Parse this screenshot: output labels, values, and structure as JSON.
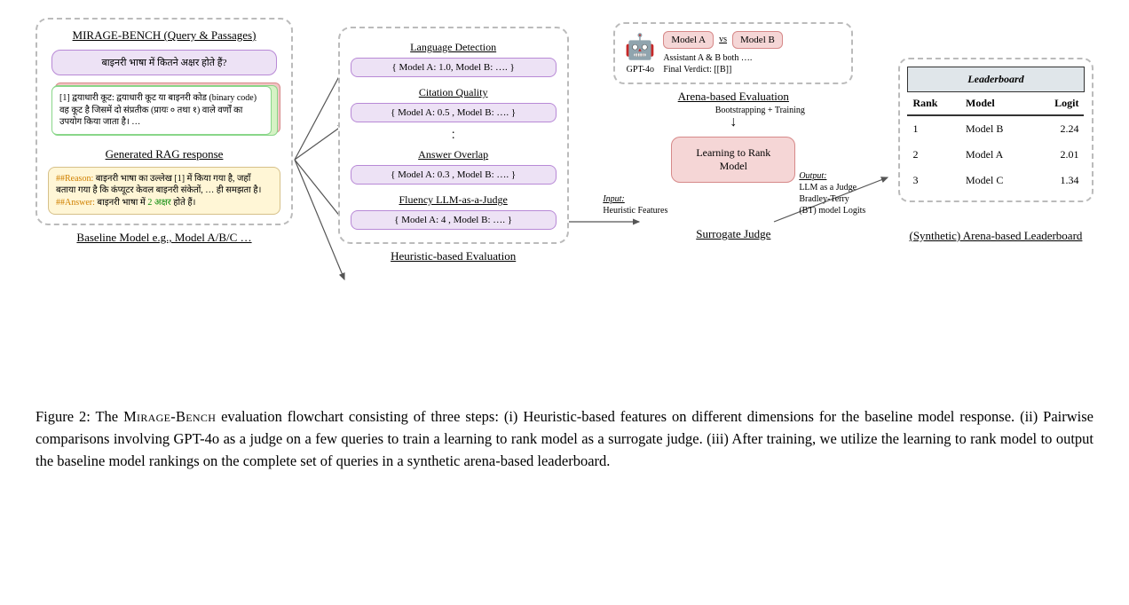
{
  "col1": {
    "title": "MIRAGE-BENCH (Query & Passages)",
    "query": "बाइनरी भाषा में कितने अक्षर होते हैं?",
    "passage": "[1] द्वयाधारी कूट: द्वयाधारी कूट या बाइनरी कोड (binary code) वह कूट है जिसमें दो संप्रतीक (प्रायः ० तथा १) वाले वर्णों का उपयोग किया जाता है। …",
    "rag_title": "Generated RAG response",
    "rag_reason_label": "##Reason:",
    "rag_reason": " बाइनरी भाषा का उल्लेख [1] में किया गया है, जहाँ बताया गया है कि कंप्यूटर केवल बाइनरी संकेतों, … ही समझता है।",
    "rag_answer_label": "##Answer:",
    "rag_answer_a": " बाइनरी भाषा में ",
    "rag_answer_b": "2 अक्षर",
    "rag_answer_c": " होते हैं।",
    "caption": "Baseline Model e.g., Model A/B/C …"
  },
  "col2": {
    "metrics": [
      {
        "title": "Language Detection",
        "value": "{ Model A:  1.0, Model B: …. }"
      },
      {
        "title": "Citation Quality",
        "value": "{ Model A:  0.5 , Model B: …. }"
      },
      {
        "title": "Answer Overlap",
        "value": "{ Model A:  0.3 , Model B: …. }"
      },
      {
        "title": "Fluency LLM-as-a-Judge",
        "value": "{ Model A:  4 , Model B: …. }"
      }
    ],
    "caption": "Heuristic-based Evaluation"
  },
  "col3": {
    "model_a": "Model A",
    "vs": "vs",
    "model_b": "Model B",
    "assistant_line": "Assistant A & B both ….",
    "verdict_line": "Final Verdict: [[B]]",
    "gpt_label": "GPT-4o",
    "arena_label": "Arena-based Evaluation",
    "boot_label": "Bootstrapping + Training",
    "ltr": "Learning to Rank Model",
    "input_title": "Input:",
    "input_text": "Heuristic Features",
    "output_title": "Output:",
    "output_text1": "LLM as a Judge",
    "output_text2": "Bradley-Terry",
    "output_text3": "(BT) model Logits",
    "caption": "Surrogate Judge"
  },
  "col4": {
    "header": "Leaderboard",
    "cols": [
      "Rank",
      "Model",
      "Logit"
    ],
    "rows": [
      {
        "rank": "1",
        "model": "Model B",
        "logit": "2.24"
      },
      {
        "rank": "2",
        "model": "Model A",
        "logit": "2.01"
      },
      {
        "rank": "3",
        "model": "Model C",
        "logit": "1.34"
      }
    ],
    "caption": "(Synthetic) Arena-based Leaderboard"
  },
  "caption": {
    "fig_label": "Figure 2: ",
    "text_a": "The ",
    "bench": "Mirage-Bench",
    "text_b": " evaluation flowchart consisting of three steps: (i) Heuristic-based features on different dimensions for the baseline model response. (ii) Pairwise comparisons involving GPT-4o as a judge on a few queries to train a learning to rank model as a surrogate judge. (iii) After training, we utilize the learning to rank model to output the baseline model rankings on the complete set of queries in a synthetic arena-based leaderboard."
  }
}
